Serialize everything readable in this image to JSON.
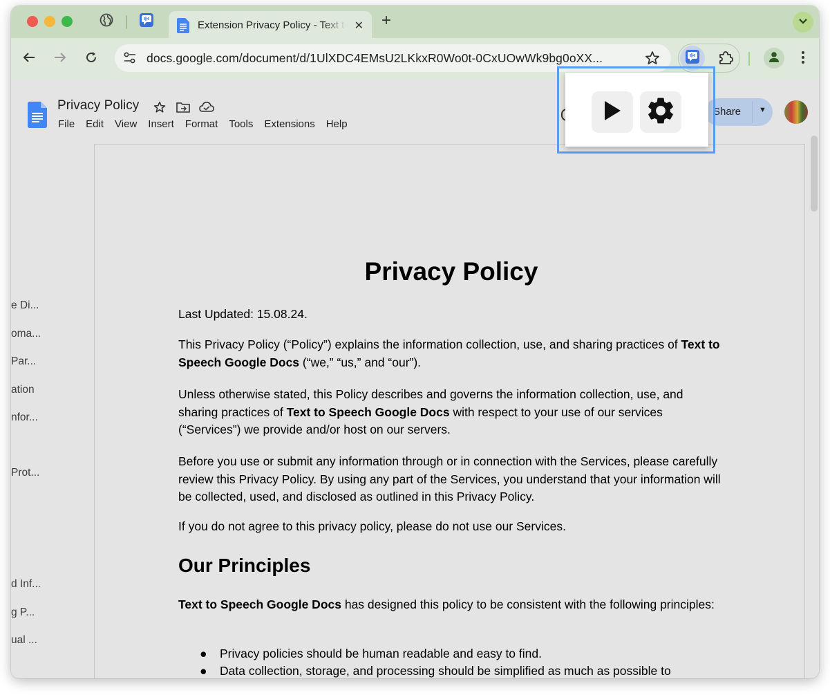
{
  "browser": {
    "active_tab": {
      "title": "Extension Privacy Policy - Text to Speech Google Docs",
      "close_glyph": "✕"
    },
    "new_tab_glyph": "+",
    "url": "docs.google.com/document/d/1UlXDC4EMsU2LKkxR0Wo0t-0CxUOwWk9bg0oXX..."
  },
  "docs": {
    "title": "Privacy Policy",
    "menu": [
      "File",
      "Edit",
      "View",
      "Insert",
      "Format",
      "Tools",
      "Extensions",
      "Help"
    ],
    "share_label": "Share"
  },
  "outline": [
    "e Di...",
    "oma...",
    "Par...",
    "ation",
    "nfor...",
    "Prot...",
    "d Inf...",
    "g P...",
    "ual ..."
  ],
  "document": {
    "h1": "Privacy Policy",
    "last_updated": "Last Updated: 15.08.24.",
    "p1_a": "This Privacy Policy (“Policy”) explains the information collection, use, and sharing practices of ",
    "p1_bold": "Text to Speech Google Docs",
    "p1_b": " (“we,” “us,” and “our”).",
    "p2_a": "Unless otherwise stated, this Policy describes and governs the information collection, use, and sharing practices of ",
    "p2_bold": "Text to Speech Google Docs",
    "p2_b": " with respect to your use of our services (“Services”) we provide and/or host on our servers.",
    "p3": "Before you use or submit any information through or in connection with the Services, please carefully review this Privacy Policy. By using any part of the Services, you understand that your information will be collected, used, and disclosed as outlined in this Privacy Policy.",
    "p4": "If you do not agree to this privacy policy, please do not use our Services.",
    "h2": "Our Principles",
    "p5_bold": "Text to Speech Google Docs",
    "p5_b": " has designed this policy to be consistent with the following principles:",
    "bullets": [
      "Privacy policies should be human readable and easy to find.",
      "Data collection, storage, and processing should be simplified as much as possible to"
    ],
    "bullet_glyph": "●"
  },
  "popup": {
    "buttons": [
      "play-icon",
      "gear-icon"
    ]
  },
  "colors": {
    "tab_strip": "#c8dbc0",
    "toolbar": "#dee8db",
    "highlight": "#5b9dea",
    "docs_blue": "#4285f4"
  }
}
